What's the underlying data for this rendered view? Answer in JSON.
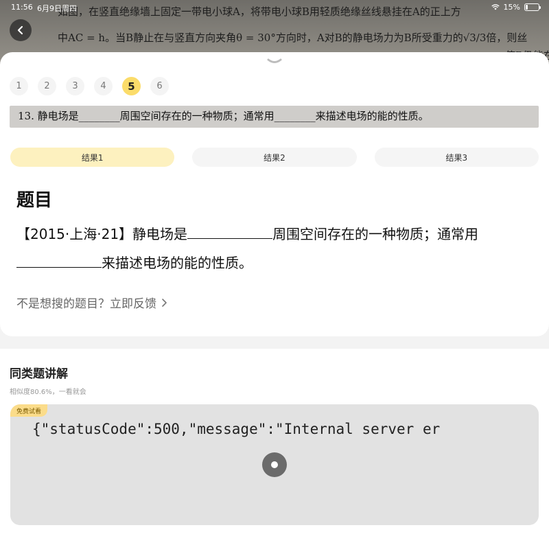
{
  "status": {
    "time": "11:56",
    "date": "6月9日周四",
    "battery": "15%"
  },
  "background": {
    "line1": "如图，在竖直绝缘墙上固定一带电小球A，将带电小球B用轻质绝缘丝线悬挂在A的正上方",
    "line2": "中AC = h。当B静止在与竖直方向夹角θ = 30°方向时，A对B的静电场力为B所受重力的√3/3倍，则丝",
    "line3": "使B仍能在"
  },
  "question_tabs": [
    "1",
    "2",
    "3",
    "4",
    "5",
    "6"
  ],
  "active_question": "5",
  "crop_text": "13.  静电场是________周围空间存在的一种物质；通常用________来描述电场的能的性质。",
  "result_tabs": [
    "结果1",
    "结果2",
    "结果3"
  ],
  "question": {
    "heading": "题目",
    "part1": "【2015·上海·21】静电场是",
    "part2": "周围空间存在的一种物质；通常用",
    "part3": "来描述电场的能的性质。"
  },
  "feedback": {
    "text": "不是想搜的题目？立即反馈"
  },
  "similar": {
    "title": "同类题讲解",
    "subtitle": "相似度80.6%，一看就会",
    "badge": "免费试看",
    "error_text": "{\"statusCode\":500,\"message\":\"Internal server er"
  }
}
